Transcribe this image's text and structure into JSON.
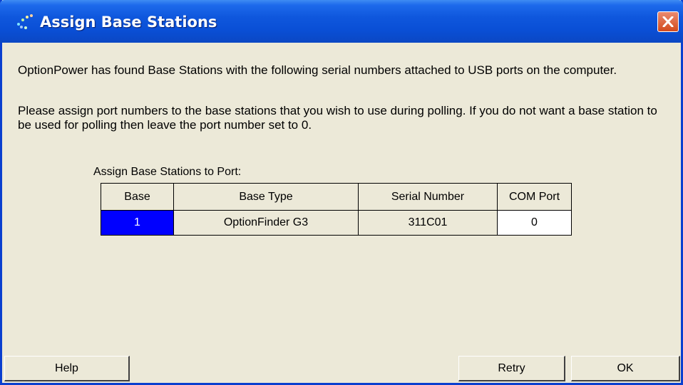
{
  "window": {
    "title": "Assign Base Stations"
  },
  "intro_text": "OptionPower has found  Base Stations with the following serial numbers attached to USB ports on the computer.",
  "instruction_text": "Please assign port numbers to the base stations that you wish to use during polling. If you do not want a base station to be used for polling then leave the port number set to 0.",
  "grid": {
    "label": "Assign Base Stations to Port:",
    "columns": [
      "Base",
      "Base Type",
      "Serial Number",
      "COM Port"
    ],
    "rows": [
      {
        "base": "1",
        "type": "OptionFinder G3",
        "serial": "311C01",
        "com_port": "0"
      }
    ]
  },
  "buttons": {
    "help": "Help",
    "retry": "Retry",
    "ok": "OK"
  },
  "colors": {
    "titlebar": "#0A4FD6",
    "selection": "#0000FF",
    "face": "#ECE9D8",
    "close": "#D34A1C"
  },
  "icons": {
    "title": "dots-app-icon",
    "close": "close-icon"
  }
}
